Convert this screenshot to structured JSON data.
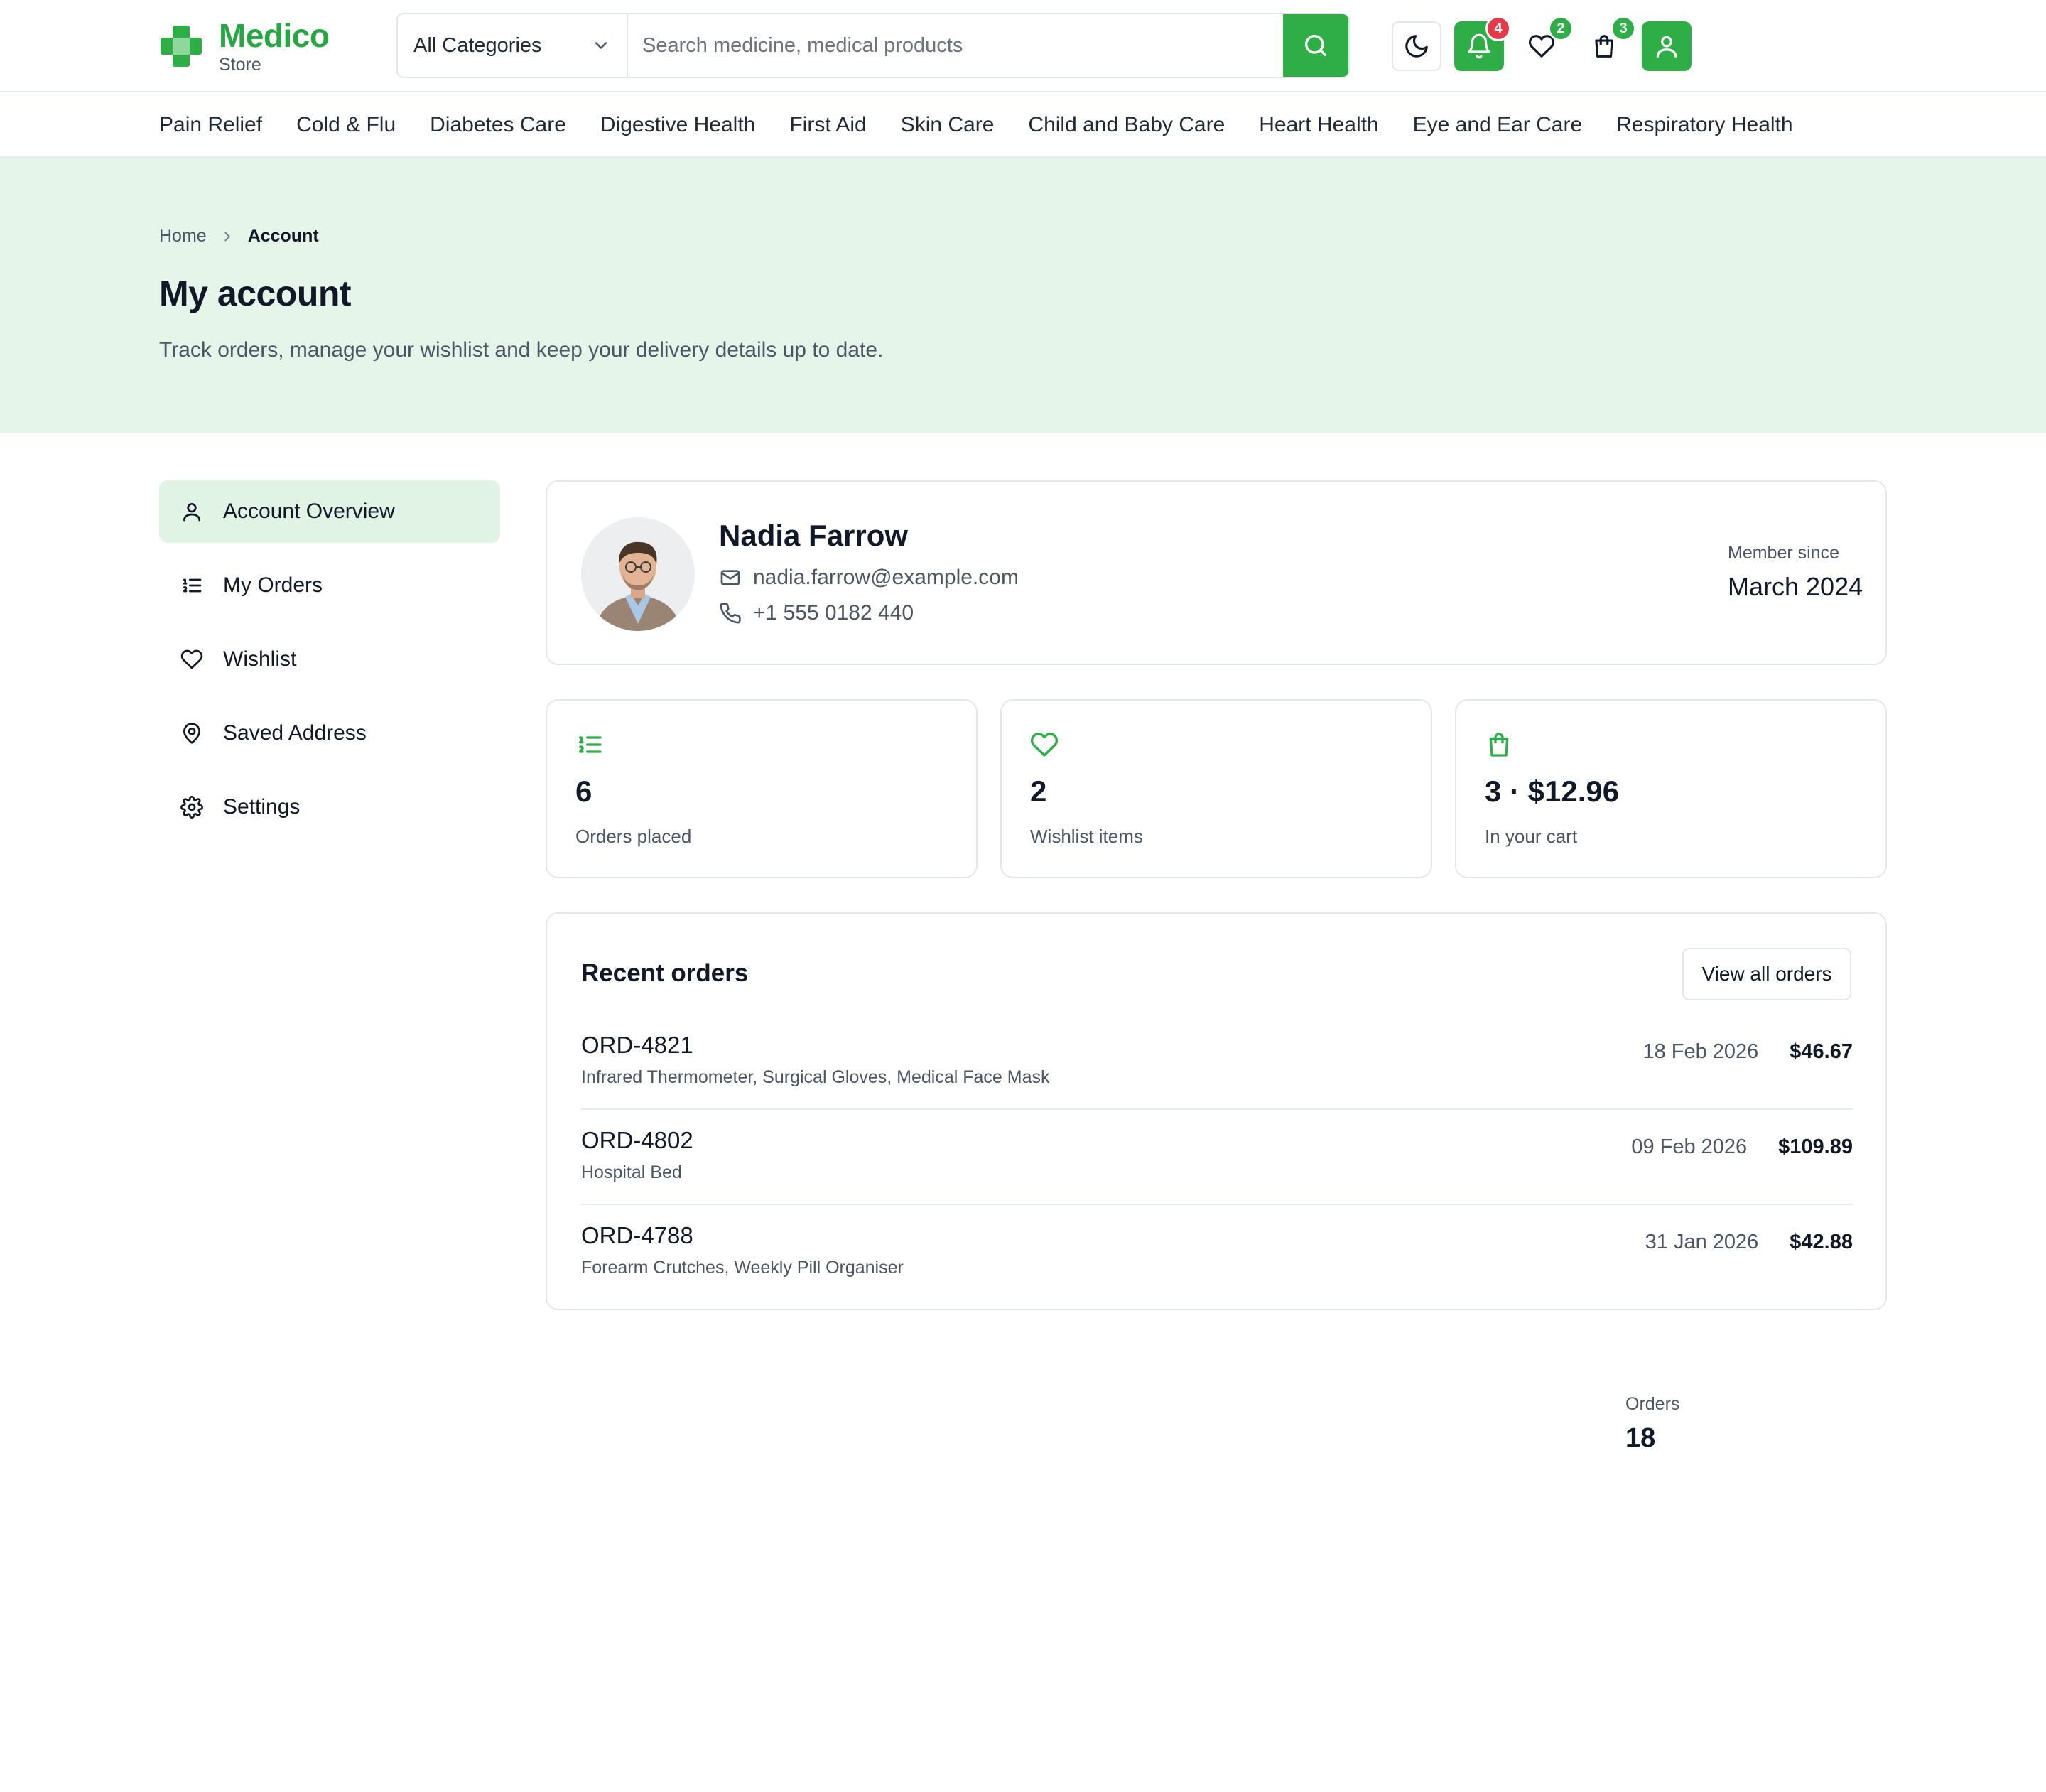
{
  "brand": {
    "name": "Medico",
    "sub": "Store",
    "accent": "#2fae47"
  },
  "search": {
    "category": "All Categories",
    "placeholder": "Search medicine, medical products"
  },
  "header_icons": {
    "theme": "moon-icon",
    "notifications": {
      "icon": "bell-icon",
      "count": "4",
      "badge_color": "#e33b49"
    },
    "wishlist": {
      "icon": "heart-icon",
      "count": "2"
    },
    "cart": {
      "icon": "shopping-bag-icon",
      "count": "3"
    },
    "account": "user-icon"
  },
  "categories": [
    "Pain Relief",
    "Cold & Flu",
    "Diabetes Care",
    "Digestive Health",
    "First Aid",
    "Skin Care",
    "Child and Baby Care",
    "Heart Health",
    "Eye and Ear Care",
    "Respiratory Health"
  ],
  "breadcrumb": {
    "home": "Home",
    "current": "Account"
  },
  "page": {
    "title": "My account",
    "subtitle": "Track orders, manage your wishlist and keep your delivery details up to date."
  },
  "sidebar": {
    "items": [
      {
        "label": "Account Overview",
        "icon": "user-icon",
        "active": true
      },
      {
        "label": "My Orders",
        "icon": "list-ordered-icon"
      },
      {
        "label": "Wishlist",
        "icon": "heart-icon"
      },
      {
        "label": "Saved Address",
        "icon": "map-pin-icon"
      },
      {
        "label": "Settings",
        "icon": "gear-icon"
      }
    ]
  },
  "profile": {
    "name": "Nadia Farrow",
    "email": "nadia.farrow@example.com",
    "phone": "+1 555 0182 440",
    "orders_label": "Orders",
    "orders_value": "18",
    "member_label": "Member since",
    "member_value": "March 2024"
  },
  "stats": [
    {
      "icon": "list-ordered-icon",
      "value": "6",
      "label": "Orders placed"
    },
    {
      "icon": "heart-icon",
      "value": "2",
      "label": "Wishlist items"
    },
    {
      "icon": "shopping-bag-icon",
      "value": "3 · $12.96",
      "label": "In your cart"
    }
  ],
  "recent_orders": {
    "title": "Recent orders",
    "view_all": "View all orders",
    "rows": [
      {
        "id": "ORD-4821",
        "items": "Infrared Thermometer, Surgical Gloves, Medical Face Mask",
        "date": "18 Feb 2026",
        "amount": "$46.67"
      },
      {
        "id": "ORD-4802",
        "items": "Hospital Bed",
        "date": "09 Feb 2026",
        "amount": "$109.89"
      },
      {
        "id": "ORD-4788",
        "items": "Forearm Crutches, Weekly Pill Organiser",
        "date": "31 Jan 2026",
        "amount": "$42.88"
      }
    ]
  }
}
